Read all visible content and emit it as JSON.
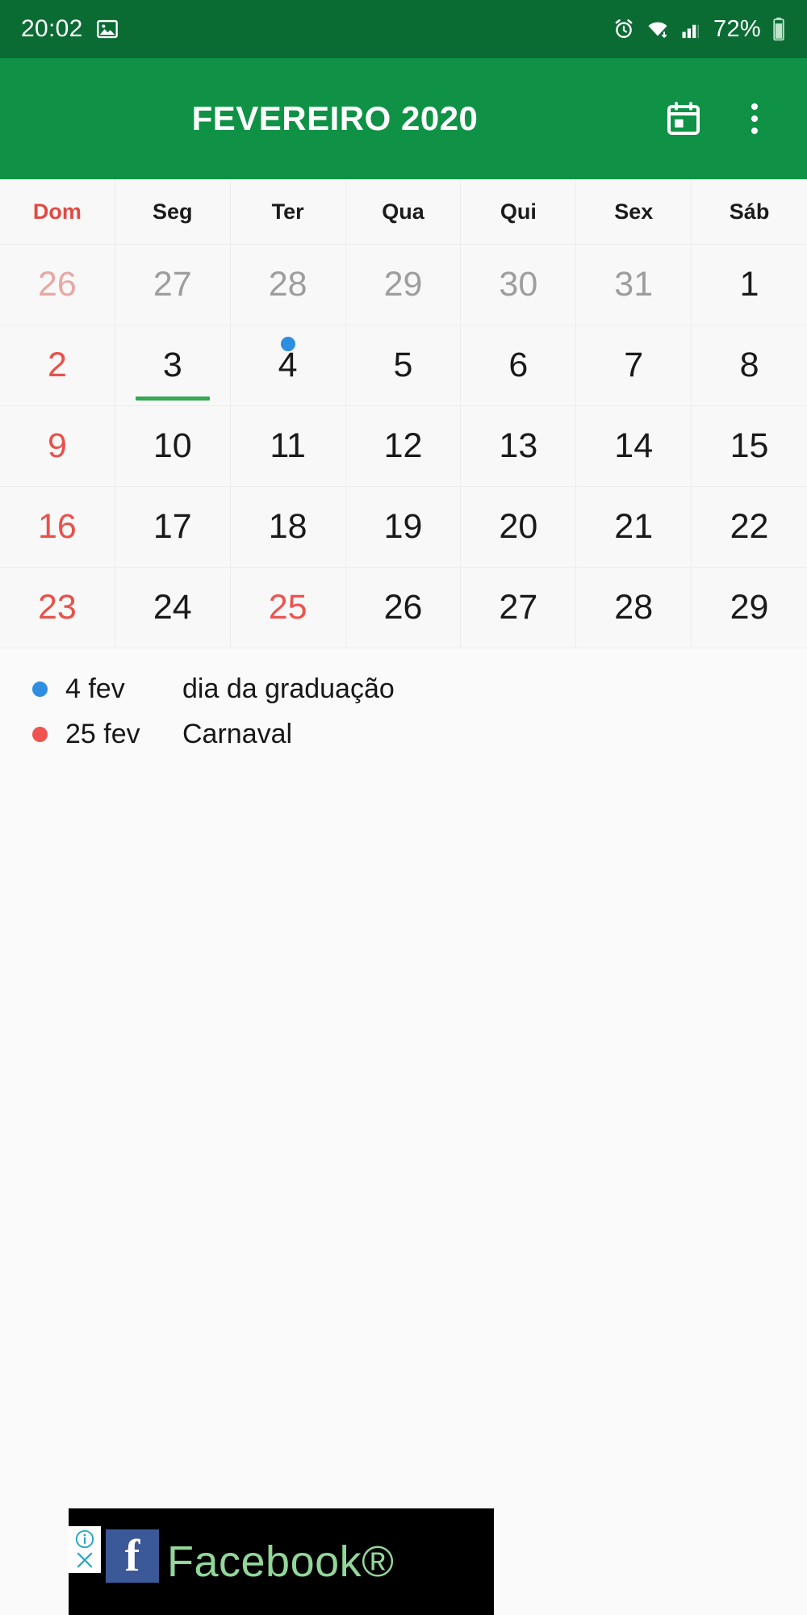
{
  "statusbar": {
    "time": "20:02",
    "battery_pct": "72%",
    "icons": [
      "image-icon",
      "alarm-icon",
      "wifi-icon",
      "signal-icon",
      "battery-icon"
    ],
    "bg_color": "#0a6b33"
  },
  "appbar": {
    "title": "FEVEREIRO 2020",
    "today_icon": "calendar-today-icon",
    "overflow_icon": "more-vertical-icon",
    "bg_color": "#0f9245"
  },
  "calendar": {
    "weekday_headers": [
      "Dom",
      "Seg",
      "Ter",
      "Qua",
      "Qui",
      "Sex",
      "Sáb"
    ],
    "sunday_color": "#e04a43",
    "today_marker_color": "#34a853",
    "weeks": [
      [
        {
          "d": "26",
          "type": "other-sun"
        },
        {
          "d": "27",
          "type": "other"
        },
        {
          "d": "28",
          "type": "other"
        },
        {
          "d": "29",
          "type": "other"
        },
        {
          "d": "30",
          "type": "other"
        },
        {
          "d": "31",
          "type": "other"
        },
        {
          "d": "1",
          "type": "normal"
        }
      ],
      [
        {
          "d": "2",
          "type": "sun"
        },
        {
          "d": "3",
          "type": "normal",
          "today": true
        },
        {
          "d": "4",
          "type": "normal",
          "dot": "#2e8ee0"
        },
        {
          "d": "5",
          "type": "normal"
        },
        {
          "d": "6",
          "type": "normal"
        },
        {
          "d": "7",
          "type": "normal"
        },
        {
          "d": "8",
          "type": "normal"
        }
      ],
      [
        {
          "d": "9",
          "type": "sun"
        },
        {
          "d": "10",
          "type": "normal"
        },
        {
          "d": "11",
          "type": "normal"
        },
        {
          "d": "12",
          "type": "normal"
        },
        {
          "d": "13",
          "type": "normal"
        },
        {
          "d": "14",
          "type": "normal"
        },
        {
          "d": "15",
          "type": "normal"
        }
      ],
      [
        {
          "d": "16",
          "type": "sun"
        },
        {
          "d": "17",
          "type": "normal"
        },
        {
          "d": "18",
          "type": "normal"
        },
        {
          "d": "19",
          "type": "normal"
        },
        {
          "d": "20",
          "type": "normal"
        },
        {
          "d": "21",
          "type": "normal"
        },
        {
          "d": "22",
          "type": "normal"
        }
      ],
      [
        {
          "d": "23",
          "type": "sun"
        },
        {
          "d": "24",
          "type": "normal"
        },
        {
          "d": "25",
          "type": "holiday"
        },
        {
          "d": "26",
          "type": "normal"
        },
        {
          "d": "27",
          "type": "normal"
        },
        {
          "d": "28",
          "type": "normal"
        },
        {
          "d": "29",
          "type": "normal"
        }
      ]
    ]
  },
  "events": [
    {
      "date": "4 fev",
      "title": "dia da graduação",
      "color": "#2e8ee0"
    },
    {
      "date": "25 fev",
      "title": "Carnaval",
      "color": "#ef5350"
    }
  ],
  "ad": {
    "text": "Facebook®",
    "logo_letter": "f",
    "logo_color": "#3b5998",
    "text_color": "#92d69a",
    "bg_color": "#000000",
    "cta_icon": "arrow-right-icon",
    "info_icon": "adchoices-info-icon",
    "close_icon": "close-icon"
  }
}
